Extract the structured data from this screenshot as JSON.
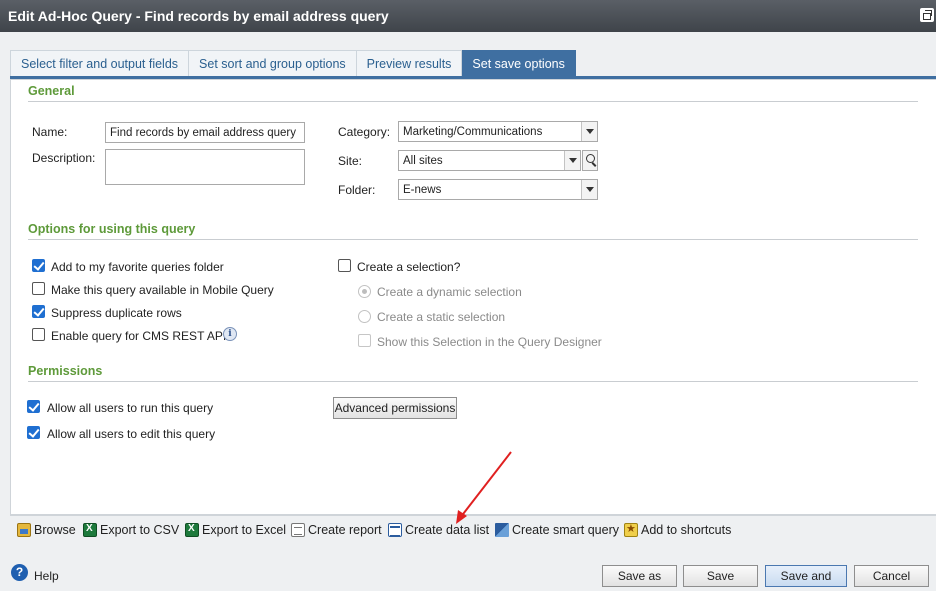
{
  "window": {
    "title": "Edit Ad-Hoc Query - Find records by email address query"
  },
  "tabs": [
    {
      "label": "Select filter and output fields",
      "active": false
    },
    {
      "label": "Set sort and group options",
      "active": false
    },
    {
      "label": "Preview results",
      "active": false
    },
    {
      "label": "Set save options",
      "active": true
    }
  ],
  "general": {
    "title": "General",
    "name_label": "Name:",
    "name_value": "Find records by email address query",
    "description_label": "Description:",
    "description_value": "",
    "category_label": "Category:",
    "category_value": "Marketing/Communications",
    "site_label": "Site:",
    "site_value": "All sites",
    "folder_label": "Folder:",
    "folder_value": "E-news"
  },
  "options": {
    "title": "Options for using this query",
    "add_favorite": {
      "label": "Add to my favorite queries folder",
      "checked": true
    },
    "mobile_query": {
      "label": "Make this query available in Mobile Query",
      "checked": false
    },
    "suppress_duplicates": {
      "label": "Suppress duplicate rows",
      "checked": true
    },
    "cms_rest": {
      "label": "Enable query for CMS REST API",
      "checked": false
    },
    "create_selection": {
      "label": "Create a selection?",
      "checked": false
    },
    "dynamic_selection": {
      "label": "Create a dynamic selection",
      "selected": true
    },
    "static_selection": {
      "label": "Create a static selection",
      "selected": false
    },
    "show_selection": {
      "label": "Show this Selection in the Query Designer",
      "checked": false
    }
  },
  "permissions": {
    "title": "Permissions",
    "run_all": {
      "label": "Allow all users to run this query",
      "checked": true
    },
    "edit_all": {
      "label": "Allow all users to edit this query",
      "checked": true
    },
    "advanced_label": "Advanced permissions"
  },
  "toolbar": {
    "browse": "Browse",
    "export_csv": "Export to CSV",
    "export_excel": "Export to Excel",
    "create_report": "Create report",
    "create_data_list": "Create data list",
    "create_smart_query": "Create smart query",
    "add_shortcuts": "Add to shortcuts"
  },
  "footer": {
    "help": "Help",
    "save_as": "Save as",
    "save": "Save",
    "save_close": "Save and close",
    "cancel": "Cancel"
  },
  "annotation_color": "#e02020"
}
